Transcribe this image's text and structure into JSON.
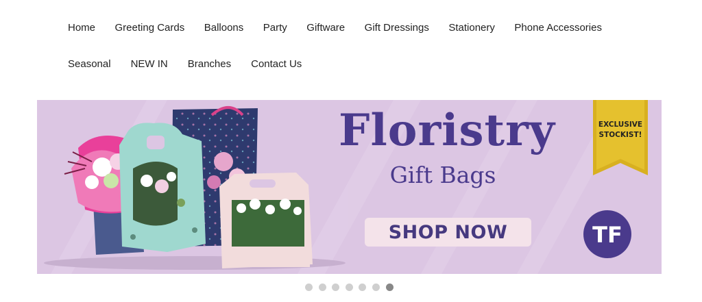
{
  "nav": {
    "row1": [
      "Home",
      "Greeting Cards",
      "Balloons",
      "Party",
      "Giftware",
      "Gift Dressings",
      "Stationery",
      "Phone Accessories"
    ],
    "row2": [
      "Seasonal",
      "NEW IN",
      "Branches",
      "Contact Us"
    ]
  },
  "banner": {
    "headline": "Floristry",
    "subheadline": "Gift Bags",
    "cta_label": "SHOP NOW",
    "ribbon_line1": "EXCLUSIVE",
    "ribbon_line2": "STOCKIST!",
    "logo_text": "TF",
    "colors": {
      "background": "#dcc6e3",
      "headline": "#4a3a8c",
      "cta_bg": "#f4e3ea",
      "ribbon_gold": "#d8b020",
      "logo_bg": "#4a3a8c"
    }
  },
  "carousel": {
    "slide_count": 7,
    "active_index": 6
  }
}
